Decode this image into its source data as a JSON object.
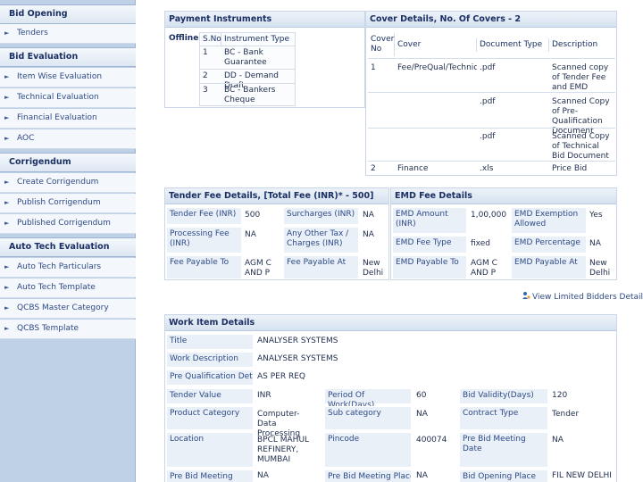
{
  "sidebar": {
    "bid_opening": {
      "title": "Bid Opening",
      "items": [
        "Tenders"
      ]
    },
    "bid_evaluation": {
      "title": "Bid Evaluation",
      "items": [
        "Item Wise Evaluation",
        "Technical Evaluation",
        "Financial Evaluation",
        "AOC"
      ]
    },
    "corrigendum": {
      "title": "Corrigendum",
      "items": [
        "Create Corrigendum",
        "Publish Corrigendum",
        "Published Corrigendum"
      ]
    },
    "auto_tech": {
      "title": "Auto Tech Evaluation",
      "items": [
        "Auto Tech Particulars",
        "Auto Tech Template",
        "QCBS Master Category",
        "QCBS Template"
      ]
    }
  },
  "payment": {
    "title": "Payment Instruments",
    "mode": "Offline",
    "col_sno": "S.No",
    "col_type": "Instrument Type",
    "rows": [
      {
        "sno": "1",
        "type": "BC - Bank Guarantee"
      },
      {
        "sno": "2",
        "type": "DD - Demand Draft"
      },
      {
        "sno": "3",
        "type": "BC - Bankers Cheque"
      }
    ]
  },
  "cover": {
    "title": "Cover Details, No. Of Covers - 2",
    "col_no": "Cover No",
    "col_cover": "Cover",
    "col_doc": "Document Type",
    "col_desc": "Description",
    "rows": [
      {
        "no": "1",
        "cover": "Fee/PreQual/Technical",
        "doc": ".pdf",
        "desc": "Scanned copy of Tender Fee and EMD"
      },
      {
        "no": "",
        "cover": "",
        "doc": ".pdf",
        "desc": "Scanned Copy of Pre-Qualification Document"
      },
      {
        "no": "",
        "cover": "",
        "doc": ".pdf",
        "desc": "Scanned Copy of Technical Bid Document"
      },
      {
        "no": "2",
        "cover": "Finance",
        "doc": ".xls",
        "desc": "Price Bid"
      }
    ]
  },
  "tender_fee": {
    "title": "Tender Fee Details, [Total Fee (INR)* - 500]",
    "fee_label": "Tender Fee (INR)",
    "fee_value": "500",
    "surcharge_label": "Surcharges (INR)",
    "surcharge_value": "NA",
    "processing_label": "Processing Fee (INR)",
    "processing_value": "NA",
    "othertax_label": "Any Other Tax / Charges (INR)",
    "othertax_value": "NA",
    "payable_to_label": "Fee Payable To",
    "payable_to_value": "AGM C AND P",
    "payable_at_label": "Fee Payable At",
    "payable_at_value": "New Delhi"
  },
  "emd": {
    "title": "EMD Fee Details",
    "amount_label": "EMD Amount (INR)",
    "amount_value": "1,00,000",
    "exemption_label": "EMD Exemption Allowed",
    "exemption_value": "Yes",
    "feetype_label": "EMD Fee Type",
    "feetype_value": "fixed",
    "percentage_label": "EMD Percentage",
    "percentage_value": "NA",
    "payable_to_label": "EMD Payable To",
    "payable_to_value": "AGM C AND P",
    "payable_at_label": "EMD Payable At",
    "payable_at_value": "New Delhi"
  },
  "bidders_link": "View Limited Bidders Details",
  "work": {
    "title": "Work Item Details",
    "title_label": "Title",
    "title_value": "ANALYSER SYSTEMS",
    "desc_label": "Work Description",
    "desc_value": "ANALYSER SYSTEMS",
    "prequal_label": "Pre Qualification Details",
    "prequal_value": "AS PER REQ",
    "tender_value_label": "Tender Value",
    "tender_value_value": "INR",
    "period_label": "Period Of Work(Days)",
    "period_value": "60",
    "validity_label": "Bid Validity(Days)",
    "validity_value": "120",
    "category_label": "Product Category",
    "category_value": "Computer- Data Processing",
    "subcat_label": "Sub category",
    "subcat_value": "NA",
    "contract_label": "Contract Type",
    "contract_value": "Tender",
    "location_label": "Location",
    "location_value": "BPCL MAHUL REFINERY, MUMBAI",
    "pincode_label": "Pincode",
    "pincode_value": "400074",
    "prebid_date_label": "Pre Bid Meeting Date",
    "prebid_date_value": "NA",
    "prebid_label": "Pre Bid Meeting",
    "prebid_value": "NA",
    "prebid_place_label": "Pre Bid Meeting Place",
    "prebid_place_value": "NA",
    "opening_place_label": "Bid Opening Place",
    "opening_place_value": "FIL NEW DELHI"
  }
}
